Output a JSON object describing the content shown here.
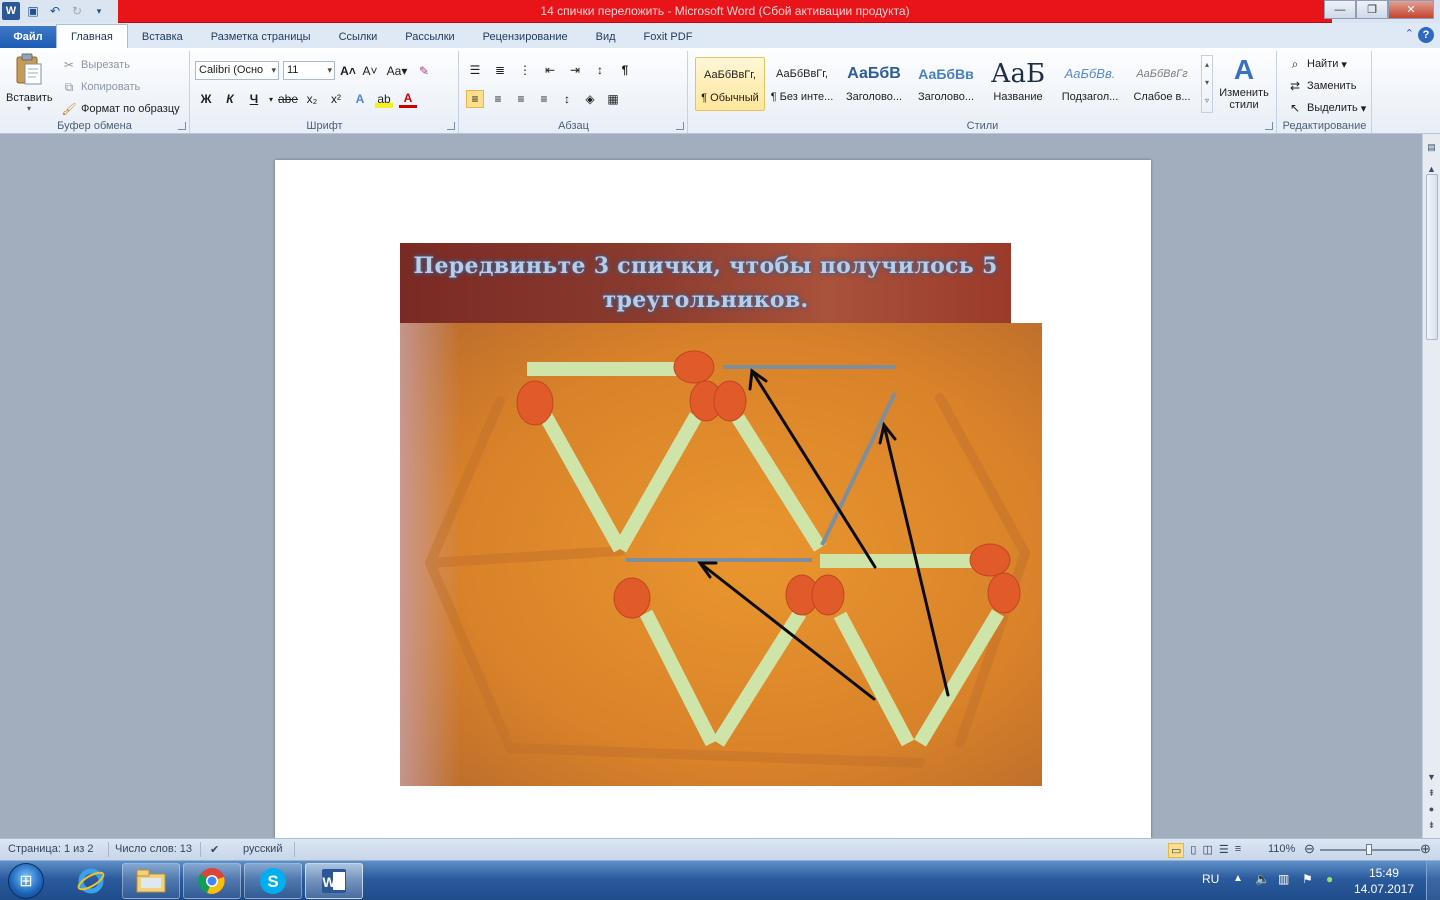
{
  "window": {
    "title": "14 спички переложить - Microsoft Word (Сбой активации продукта)",
    "app_icon": "word-icon",
    "controls": [
      "minimize",
      "maximize",
      "close"
    ]
  },
  "ribbon_tabs": [
    "Файл",
    "Главная",
    "Вставка",
    "Разметка страницы",
    "Ссылки",
    "Рассылки",
    "Рецензирование",
    "Вид",
    "Foxit PDF"
  ],
  "active_tab": "Главная",
  "clipboard": {
    "paste": "Вставить",
    "cut": "Вырезать",
    "copy": "Копировать",
    "format_painter": "Формат по образцу",
    "label": "Буфер обмена"
  },
  "font": {
    "family": "Calibri (Осно",
    "size": "11",
    "bold": "Ж",
    "italic": "К",
    "underline": "Ч",
    "strike": "abe",
    "case": "Aa",
    "label": "Шрифт"
  },
  "paragraph": {
    "label": "Абзац"
  },
  "styles": {
    "items": [
      {
        "preview": "АаБбВвГг,",
        "name": "¶ Обычный"
      },
      {
        "preview": "АаБбВвГг,",
        "name": "¶ Без инте..."
      },
      {
        "preview": "АаБбВ",
        "name": "Заголово..."
      },
      {
        "preview": "АаБбВв",
        "name": "Заголово..."
      },
      {
        "preview": "АаБ",
        "name": "Название"
      },
      {
        "preview": "АаБбВв.",
        "name": "Подзагол..."
      },
      {
        "preview": "АаБбВвГг",
        "name": "Слабое в..."
      }
    ],
    "change": "Изменить стили",
    "label": "Стили"
  },
  "editing": {
    "find": "Найти",
    "replace": "Заменить",
    "select": "Выделить",
    "label": "Редактирование"
  },
  "document": {
    "banner_line1": "Передвиньте 3 спички, чтобы получилось 5",
    "banner_line2": "треугольников."
  },
  "status": {
    "page": "Страница: 1 из 2",
    "words": "Число слов: 13",
    "language": "русский",
    "zoom": "110%"
  },
  "taskbar": {
    "apps": [
      "start-orb",
      "internet-explorer-icon",
      "file-explorer-icon",
      "chrome-icon",
      "skype-icon",
      "word-icon"
    ],
    "lang": "RU",
    "time": "15:49",
    "date": "14.07.2017"
  }
}
